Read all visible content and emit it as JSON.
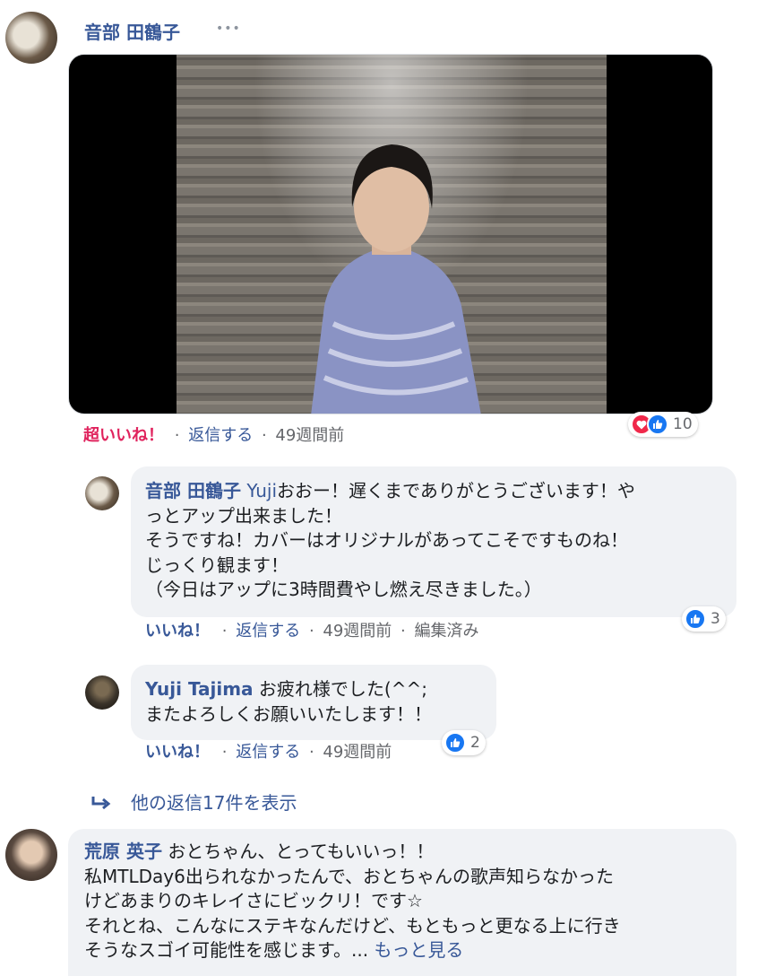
{
  "post_comment": {
    "author": "音部 田鶴子",
    "more_options": "•••",
    "reaction_label": "超いいね！",
    "reply_label": "返信する",
    "time": "49週間前",
    "reaction_count": "10"
  },
  "replies": [
    {
      "author": "音部 田鶴子",
      "mention": "Yuji",
      "lines": [
        "おおー！遅くまでありがとうございます！や",
        "っとアップ出来ました！",
        "そうですね！カバーはオリジナルがあってこそですものね！",
        "じっくり観ます！",
        "（今日はアップに3時間費やし燃え尽きました。）"
      ],
      "like_label": "いいね！",
      "reply_label": "返信する",
      "time": "49週間前",
      "edited": "編集済み",
      "reaction_count": "3"
    },
    {
      "author": "Yuji Tajima",
      "lines": [
        "お疲れ様でした(^^;",
        "またよろしくお願いいたします！！"
      ],
      "like_label": "いいね！",
      "reply_label": "返信する",
      "time": "49週間前",
      "reaction_count": "2"
    }
  ],
  "more_replies": "他の返信17件を表示",
  "next_comment": {
    "author": "荒原 英子",
    "lines": [
      "おとちゃん、とってもいいっ！！",
      "私MTLDay6出られなかったんで、おとちゃんの歌声知らなかった",
      "けどあまりのキレイさにビックリ！です☆",
      "それとね、こんなにステキなんだけど、もともっと更なる上に行き",
      "そうなスゴイ可能性を感じます。..."
    ],
    "see_more": "もっと見る"
  },
  "separator": "·",
  "colors": {
    "name_blue": "#385898",
    "love_red": "#e0245e",
    "like_blue": "#1877f2",
    "bubble_gray": "#f0f2f5"
  }
}
